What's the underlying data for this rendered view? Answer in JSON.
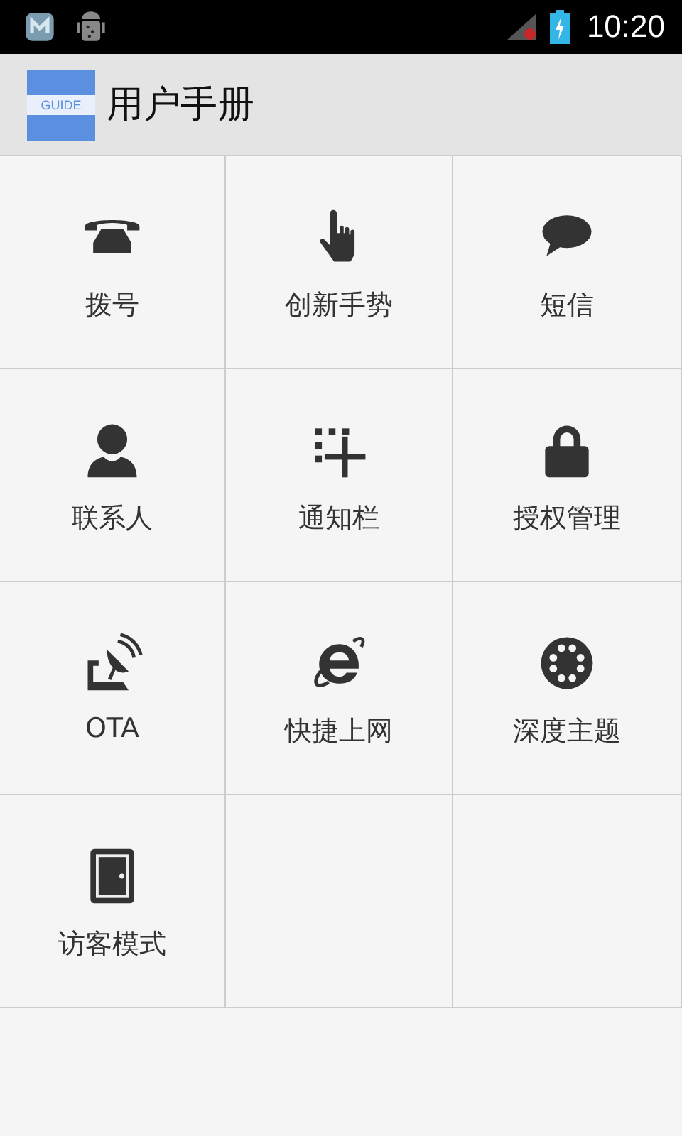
{
  "status_bar": {
    "time": "10:20"
  },
  "action_bar": {
    "icon_label": "GUIDE",
    "title": "用户手册"
  },
  "items": [
    {
      "label": "拨号",
      "kind": "phone"
    },
    {
      "label": "创新手势",
      "kind": "hand"
    },
    {
      "label": "短信",
      "kind": "chat"
    },
    {
      "label": "联系人",
      "kind": "person"
    },
    {
      "label": "通知栏",
      "kind": "notify"
    },
    {
      "label": "授权管理",
      "kind": "lock"
    },
    {
      "label": "OTA",
      "kind": "satellite"
    },
    {
      "label": "快捷上网",
      "kind": "browser"
    },
    {
      "label": "深度主题",
      "kind": "dial"
    },
    {
      "label": "访客模式",
      "kind": "door"
    }
  ]
}
